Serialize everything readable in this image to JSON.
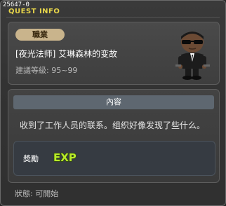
{
  "window": {
    "id": "25647-0",
    "title": "QUEST INFO"
  },
  "quest": {
    "job_badge": "職業",
    "name": "[夜光法师] 艾琳森林的变故",
    "level": "建議等級: 95~99",
    "npc_icon": "npc-portrait-icon"
  },
  "content": {
    "header": "內容",
    "text": "收到了工作人员的联系。组织好像发现了些什么。",
    "reward_label": "奬勵",
    "reward_icon_text": "EXP"
  },
  "status": "狀態: 可開始",
  "colors": {
    "title": "#e8d64a",
    "badge": "#c9b48c",
    "exp_green": "#b8ea2a"
  }
}
